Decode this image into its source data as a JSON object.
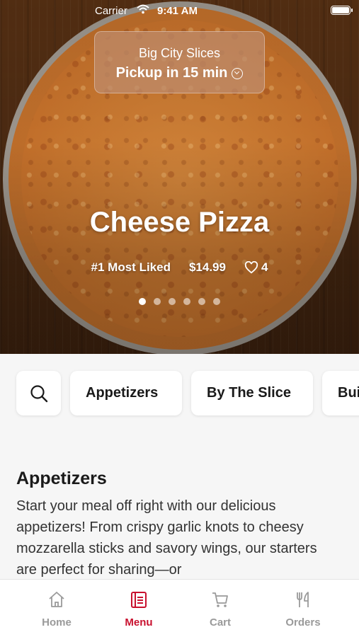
{
  "status_bar": {
    "carrier": "Carrier",
    "time": "9:41 AM"
  },
  "store": {
    "name": "Big City Slices",
    "pickup": "Pickup in 15 min"
  },
  "featured": {
    "title": "Cheese Pizza",
    "rank": "#1 Most Liked",
    "price": "$14.99",
    "likes": "4",
    "slide_count": 6,
    "active_slide": 0
  },
  "categories": [
    "Appetizers",
    "By The Slice",
    "Bui"
  ],
  "section": {
    "title": "Appetizers",
    "description": "Start your meal off right with our delicious appetizers! From crispy garlic knots to cheesy mozzarella sticks and savory wings, our starters are perfect for sharing—or"
  },
  "tabs": [
    {
      "label": "Home",
      "icon": "home-icon"
    },
    {
      "label": "Menu",
      "icon": "menu-book-icon",
      "active": true
    },
    {
      "label": "Cart",
      "icon": "cart-icon"
    },
    {
      "label": "Orders",
      "icon": "fork-knife-icon"
    }
  ],
  "colors": {
    "accent": "#c8102e",
    "inactive_tab": "#9a9a9a"
  }
}
